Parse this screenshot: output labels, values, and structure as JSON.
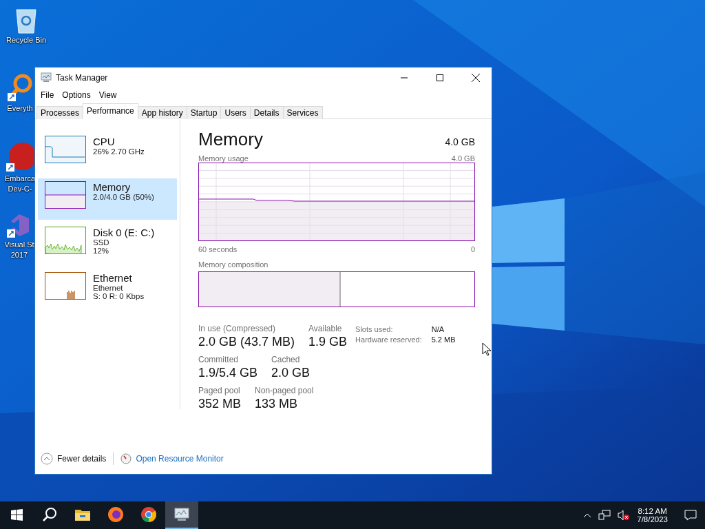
{
  "desktop_icons": [
    {
      "kind": "recycle",
      "lines": [
        "Recycle Bin"
      ]
    },
    {
      "kind": "everything",
      "lines": [
        "Everyth"
      ]
    },
    {
      "kind": "devcpp",
      "lines": [
        "Embarca",
        "Dev-C-"
      ]
    },
    {
      "kind": "vs",
      "lines": [
        "Visual St",
        "2017"
      ]
    }
  ],
  "window": {
    "title": "Task Manager",
    "menu": [
      "File",
      "Options",
      "View"
    ],
    "tabs": [
      {
        "label": "Processes",
        "selected": false
      },
      {
        "label": "Performance",
        "selected": true
      },
      {
        "label": "App history",
        "selected": false
      },
      {
        "label": "Startup",
        "selected": false
      },
      {
        "label": "Users",
        "selected": false
      },
      {
        "label": "Details",
        "selected": false
      },
      {
        "label": "Services",
        "selected": false
      }
    ],
    "sidebar": [
      {
        "kind": "cpu",
        "name": "CPU",
        "lines": [
          "26%  2.70 GHz"
        ],
        "color": "#117dbb",
        "selected": false
      },
      {
        "kind": "memory",
        "name": "Memory",
        "lines": [
          "2.0/4.0 GB (50%)"
        ],
        "color": "#8b12ae",
        "selected": true
      },
      {
        "kind": "disk",
        "name": "Disk 0 (E: C:)",
        "lines": [
          "SSD",
          "12%"
        ],
        "color": "#4da60c",
        "selected": false
      },
      {
        "kind": "ethernet",
        "name": "Ethernet",
        "lines": [
          "Ethernet",
          "S: 0 R: 0 Kbps"
        ],
        "color": "#a74f01",
        "selected": false
      }
    ],
    "detail": {
      "title": "Memory",
      "total": "4.0 GB",
      "usage_label": "Memory usage",
      "usage_max": "4.0 GB",
      "time_label": "60 seconds",
      "usage_min": "0",
      "composition_label": "Memory composition",
      "composition": {
        "level": 0.51
      },
      "stats": [
        [
          {
            "label": "In use (Compressed)",
            "value": "2.0 GB (43.7 MB)"
          },
          {
            "label": "Available",
            "value": "1.9 GB"
          }
        ],
        [
          {
            "label": "Committed",
            "value": "1.9/5.4 GB"
          },
          {
            "label": "Cached",
            "value": "2.0 GB"
          }
        ],
        [
          {
            "label": "Paged pool",
            "value": "352 MB"
          },
          {
            "label": "Non-paged pool",
            "value": "133 MB"
          }
        ]
      ],
      "side_stats": [
        {
          "label": "Slots used:",
          "value": "N/A"
        },
        {
          "label": "Hardware reserved:",
          "value": "5.2 MB"
        }
      ]
    },
    "footer": {
      "fewer": "Fewer details",
      "link": "Open Resource Monitor"
    }
  },
  "taskbar": {
    "apps": [
      {
        "kind": "start",
        "selected": false
      },
      {
        "kind": "search",
        "selected": false
      },
      {
        "kind": "explorer",
        "selected": false
      },
      {
        "kind": "firefox",
        "selected": false
      },
      {
        "kind": "chrome",
        "selected": false
      },
      {
        "kind": "taskmgr",
        "selected": true
      }
    ],
    "time": "8:12 AM",
    "date": "7/8/2023"
  }
}
